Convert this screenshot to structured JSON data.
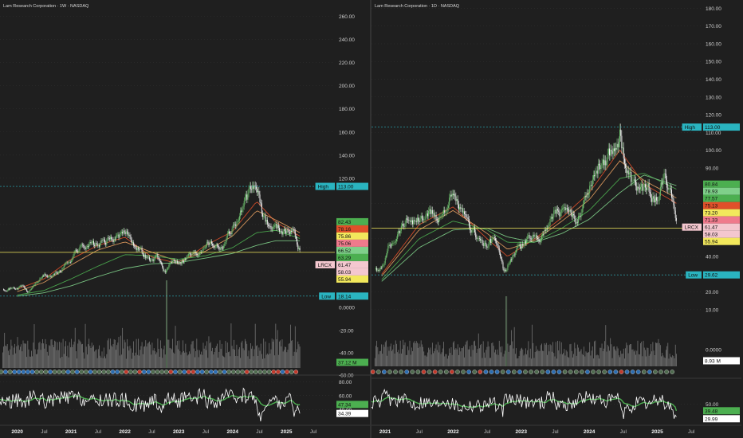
{
  "colors": {
    "background": "#1f1f1f",
    "price_line": "#ffffff",
    "ma_fast": "#e0502a",
    "ma_mid": "#e8a060",
    "ma_slow": "#4caf50",
    "ma_long": "#7fd08a",
    "volume": "#b8b8b8",
    "rsi_line": "#ffffff",
    "rsi_signal": "#4caf50",
    "high_low_label": "#2ab4c0",
    "support_line": "#f2e85c",
    "grid": "#3a3a3a"
  },
  "chart_data": [
    {
      "type": "line",
      "title": "Lam Research Corporation · 1W · NASDAQ",
      "x_labels": [
        "2020",
        "Jul",
        "2021",
        "Jul",
        "2022",
        "Jul",
        "2023",
        "Jul",
        "2024",
        "Jul",
        "2025",
        "Jul"
      ],
      "y_ticks": [
        "260.00",
        "240.00",
        "220.00",
        "200.00",
        "180.00",
        "160.00",
        "140.00",
        "120.00",
        "80.00",
        "60.00",
        "40.00"
      ],
      "lower_axis_ticks": [
        "0.0000",
        "-20.00",
        "-40.00",
        "-60.00"
      ],
      "ylim": [
        18,
        270
      ],
      "ylog": false,
      "series_points": [
        [
          2020.0,
          25
        ],
        [
          2020.1,
          27
        ],
        [
          2020.2,
          21
        ],
        [
          2020.35,
          30
        ],
        [
          2020.5,
          36
        ],
        [
          2020.65,
          35
        ],
        [
          2020.8,
          40
        ],
        [
          2020.95,
          48
        ],
        [
          2021.1,
          58
        ],
        [
          2021.3,
          64
        ],
        [
          2021.5,
          62
        ],
        [
          2021.7,
          66
        ],
        [
          2021.9,
          70
        ],
        [
          2022.05,
          72
        ],
        [
          2022.2,
          63
        ],
        [
          2022.35,
          55
        ],
        [
          2022.5,
          48
        ],
        [
          2022.6,
          52
        ],
        [
          2022.75,
          39
        ],
        [
          2022.9,
          48
        ],
        [
          2023.05,
          50
        ],
        [
          2023.2,
          55
        ],
        [
          2023.35,
          55
        ],
        [
          2023.5,
          67
        ],
        [
          2023.65,
          64
        ],
        [
          2023.8,
          62
        ],
        [
          2023.95,
          75
        ],
        [
          2024.1,
          85
        ],
        [
          2024.2,
          95
        ],
        [
          2024.35,
          108
        ],
        [
          2024.45,
          113
        ],
        [
          2024.55,
          88
        ],
        [
          2024.7,
          78
        ],
        [
          2024.85,
          78
        ],
        [
          2025.0,
          74
        ],
        [
          2025.12,
          76
        ],
        [
          2025.25,
          58
        ]
      ],
      "ma_points": {
        "fast": [
          [
            2020.0,
            24
          ],
          [
            2020.5,
            33
          ],
          [
            2021.0,
            50
          ],
          [
            2021.5,
            62
          ],
          [
            2022.0,
            69
          ],
          [
            2022.5,
            52
          ],
          [
            2023.0,
            46
          ],
          [
            2023.5,
            62
          ],
          [
            2024.0,
            74
          ],
          [
            2024.45,
            100
          ],
          [
            2024.8,
            82
          ],
          [
            2025.25,
            70
          ]
        ],
        "mid": [
          [
            2020.0,
            22
          ],
          [
            2020.5,
            30
          ],
          [
            2021.0,
            45
          ],
          [
            2021.5,
            58
          ],
          [
            2022.0,
            65
          ],
          [
            2022.5,
            56
          ],
          [
            2023.0,
            48
          ],
          [
            2023.5,
            57
          ],
          [
            2024.0,
            70
          ],
          [
            2024.45,
            92
          ],
          [
            2024.8,
            84
          ],
          [
            2025.25,
            73
          ]
        ],
        "slow": [
          [
            2020.0,
            19
          ],
          [
            2020.5,
            23
          ],
          [
            2021.0,
            33
          ],
          [
            2021.5,
            44
          ],
          [
            2022.0,
            54
          ],
          [
            2022.5,
            53
          ],
          [
            2023.0,
            50
          ],
          [
            2023.5,
            53
          ],
          [
            2024.0,
            60
          ],
          [
            2024.45,
            73
          ],
          [
            2024.8,
            75
          ],
          [
            2025.25,
            68
          ]
        ],
        "long": [
          [
            2020.0,
            18
          ],
          [
            2020.5,
            21
          ],
          [
            2021.0,
            27
          ],
          [
            2021.5,
            35
          ],
          [
            2022.0,
            42
          ],
          [
            2022.5,
            46
          ],
          [
            2023.0,
            47
          ],
          [
            2023.5,
            51
          ],
          [
            2024.0,
            55
          ],
          [
            2024.45,
            62
          ],
          [
            2024.8,
            66
          ],
          [
            2025.25,
            66
          ]
        ]
      },
      "price_labels": [
        {
          "text": "High",
          "value": 113.0,
          "label": "113.00",
          "color": "#2ab4c0"
        },
        {
          "text": "",
          "value": 82.43,
          "label": "82.43",
          "color": "#4caf50"
        },
        {
          "text": "",
          "value": 78.16,
          "label": "78.16",
          "color": "#e0502a"
        },
        {
          "text": "",
          "value": 75.86,
          "label": "75.86",
          "color": "#f2e85c"
        },
        {
          "text": "",
          "value": 73.06,
          "label": "75.06",
          "color": "#ef7a8c"
        },
        {
          "text": "",
          "value": 66.52,
          "label": "66.52",
          "color": "#7fd08a"
        },
        {
          "text": "",
          "value": 63.29,
          "label": "63.29",
          "color": "#4caf50"
        },
        {
          "text": "LRCX",
          "value": 61.47,
          "label": "61.47",
          "color": "#f4c7cf"
        },
        {
          "text": "",
          "value": 58.5,
          "label": "58.03",
          "color": "#f4c7cf"
        },
        {
          "text": "",
          "value": 55.94,
          "label": "55.94",
          "color": "#f2e85c"
        },
        {
          "text": "Low",
          "value": 18.14,
          "label": "18.14",
          "color": "#2ab4c0"
        }
      ],
      "support_value": 55.94,
      "volume_label": "37.12 M",
      "rsi_ticks": [
        "80.00",
        "60.00",
        "40.00"
      ],
      "rsi_ylim": [
        22,
        86
      ],
      "rsi_values": {
        "rsi": 34.39,
        "signal": 47.34
      },
      "rsi_labels": [
        "47.34",
        "34.39"
      ]
    },
    {
      "type": "line",
      "title": "Lam Research Corporation · 1D · NASDAQ",
      "x_labels": [
        "2021",
        "Jul",
        "2022",
        "Jul",
        "2023",
        "Jul",
        "2024",
        "Jul",
        "2025",
        "Jul"
      ],
      "y_ticks": [
        "180.00",
        "170.00",
        "160.00",
        "150.00",
        "140.00",
        "130.00",
        "120.00",
        "110.00",
        "100.00",
        "90.00",
        "70.00",
        "60.00",
        "50.00",
        "40.00",
        "30.00",
        "20.00",
        "10.00"
      ],
      "lower_axis_ticks": [
        "0.0000"
      ],
      "ylim": [
        5,
        182
      ],
      "ylog": false,
      "series_points": [
        [
          2020.95,
          32
        ],
        [
          2021.05,
          45
        ],
        [
          2021.2,
          55
        ],
        [
          2021.35,
          62
        ],
        [
          2021.5,
          60
        ],
        [
          2021.65,
          64
        ],
        [
          2021.8,
          62
        ],
        [
          2021.95,
          72
        ],
        [
          2022.05,
          70
        ],
        [
          2022.2,
          58
        ],
        [
          2022.35,
          52
        ],
        [
          2022.5,
          45
        ],
        [
          2022.62,
          50
        ],
        [
          2022.75,
          30
        ],
        [
          2022.9,
          42
        ],
        [
          2023.05,
          48
        ],
        [
          2023.2,
          52
        ],
        [
          2023.35,
          54
        ],
        [
          2023.5,
          68
        ],
        [
          2023.65,
          63
        ],
        [
          2023.8,
          60
        ],
        [
          2023.95,
          75
        ],
        [
          2024.05,
          86
        ],
        [
          2024.2,
          95
        ],
        [
          2024.35,
          100
        ],
        [
          2024.45,
          111
        ],
        [
          2024.55,
          88
        ],
        [
          2024.65,
          78
        ],
        [
          2024.8,
          78
        ],
        [
          2024.95,
          73
        ],
        [
          2025.1,
          82
        ],
        [
          2025.2,
          78
        ],
        [
          2025.28,
          58
        ]
      ],
      "ma_points": {
        "fast": [
          [
            2020.95,
            30
          ],
          [
            2021.5,
            58
          ],
          [
            2022.0,
            68
          ],
          [
            2022.5,
            50
          ],
          [
            2022.8,
            40
          ],
          [
            2023.2,
            50
          ],
          [
            2023.6,
            62
          ],
          [
            2024.0,
            76
          ],
          [
            2024.45,
            100
          ],
          [
            2024.8,
            81
          ],
          [
            2025.28,
            70
          ]
        ],
        "mid": [
          [
            2020.95,
            29
          ],
          [
            2021.5,
            55
          ],
          [
            2022.0,
            66
          ],
          [
            2022.5,
            53
          ],
          [
            2022.8,
            44
          ],
          [
            2023.2,
            49
          ],
          [
            2023.6,
            60
          ],
          [
            2024.0,
            72
          ],
          [
            2024.45,
            94
          ],
          [
            2024.8,
            83
          ],
          [
            2025.28,
            73
          ]
        ],
        "slow": [
          [
            2020.95,
            27
          ],
          [
            2021.5,
            50
          ],
          [
            2022.0,
            60
          ],
          [
            2022.5,
            55
          ],
          [
            2022.8,
            48
          ],
          [
            2023.2,
            48
          ],
          [
            2023.6,
            56
          ],
          [
            2024.0,
            66
          ],
          [
            2024.45,
            84
          ],
          [
            2024.8,
            87
          ],
          [
            2025.28,
            78
          ]
        ],
        "long": [
          [
            2020.95,
            26
          ],
          [
            2021.5,
            45
          ],
          [
            2022.0,
            55
          ],
          [
            2022.5,
            56
          ],
          [
            2022.8,
            51
          ],
          [
            2023.2,
            48
          ],
          [
            2023.6,
            53
          ],
          [
            2024.0,
            61
          ],
          [
            2024.45,
            76
          ],
          [
            2024.8,
            86
          ],
          [
            2025.28,
            80
          ]
        ]
      },
      "price_labels": [
        {
          "text": "High",
          "value": 113.0,
          "label": "113.00",
          "color": "#2ab4c0"
        },
        {
          "text": "",
          "value": 80.84,
          "label": "80.84",
          "color": "#4caf50"
        },
        {
          "text": "",
          "value": 78.93,
          "label": "78.93",
          "color": "#7fd08a"
        },
        {
          "text": "",
          "value": 77.57,
          "label": "77.57",
          "color": "#4caf50"
        },
        {
          "text": "",
          "value": 75.13,
          "label": "75.13",
          "color": "#e0502a"
        },
        {
          "text": "",
          "value": 73.2,
          "label": "73.20",
          "color": "#f2e85c"
        },
        {
          "text": "",
          "value": 71.33,
          "label": "71.33",
          "color": "#ef7a8c"
        },
        {
          "text": "LRCX",
          "value": 61.47,
          "label": "61.47",
          "color": "#f4c7cf"
        },
        {
          "text": "",
          "value": 58.03,
          "label": "58.03",
          "color": "#f4c7cf"
        },
        {
          "text": "",
          "value": 55.94,
          "label": "55.94",
          "color": "#f2e85c"
        },
        {
          "text": "Low",
          "value": 29.62,
          "label": "29.62",
          "color": "#2ab4c0"
        }
      ],
      "support_value": 55.94,
      "volume_label": "8.93 M",
      "rsi_ticks": [
        "50.00"
      ],
      "rsi_ylim": [
        22,
        86
      ],
      "rsi_values": {
        "rsi": 29.99,
        "signal": 39.48
      },
      "rsi_labels": [
        "39.48",
        "29.99"
      ]
    }
  ]
}
